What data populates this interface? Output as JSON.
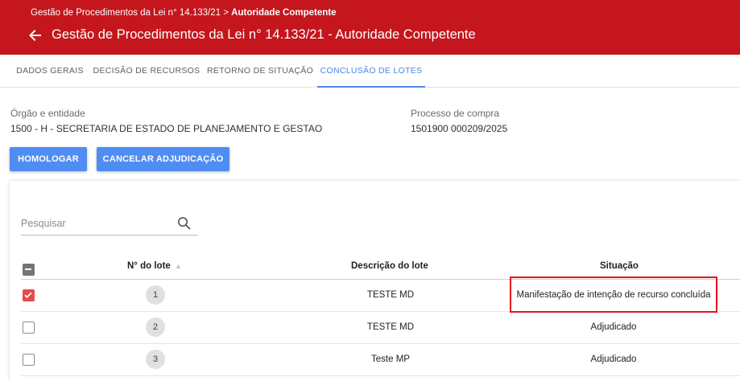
{
  "header": {
    "breadcrumb_prefix": "Gestão de Procedimentos da Lei n° 14.133/21 > ",
    "breadcrumb_current": "Autoridade Competente",
    "title": "Gestão de Procedimentos da Lei n° 14.133/21 - Autoridade Competente"
  },
  "tabs": [
    {
      "label": "DADOS GERAIS"
    },
    {
      "label": "DECISÃO DE RECURSOS"
    },
    {
      "label": "RETORNO DE SITUAÇÃO"
    },
    {
      "label": "CONCLUSÃO DE LOTES"
    }
  ],
  "active_tab": "CONCLUSÃO DE LOTES",
  "fields": {
    "orgao_label": "Órgão e entidade",
    "orgao_value": "1500 - H - SECRETARIA DE ESTADO DE PLANEJAMENTO E GESTAO",
    "processo_label": "Processo de compra",
    "processo_value": "1501900 000209/2025"
  },
  "actions": {
    "homologar": "HOMOLOGAR",
    "cancelar": "CANCELAR ADJUDICAÇÃO"
  },
  "search": {
    "placeholder": "Pesquisar",
    "value": ""
  },
  "table": {
    "columns": {
      "lote": "N° do lote",
      "sort_indicator": "▲",
      "descricao": "Descrição do lote",
      "situacao": "Situação"
    },
    "rows": [
      {
        "lote": "1",
        "descricao": "TESTE MD",
        "situacao": "Manifestação de intenção de recurso concluída",
        "checked": true
      },
      {
        "lote": "2",
        "descricao": "TESTE MD",
        "situacao": "Adjudicado",
        "checked": false
      },
      {
        "lote": "3",
        "descricao": "Teste MP",
        "situacao": "Adjudicado",
        "checked": false
      }
    ]
  },
  "colors": {
    "header_bg": "#c4161c",
    "accent": "#4a86e8",
    "button": "#4f8df3",
    "checkbox_checked": "#e84a4a",
    "highlight": "#e0141e"
  }
}
